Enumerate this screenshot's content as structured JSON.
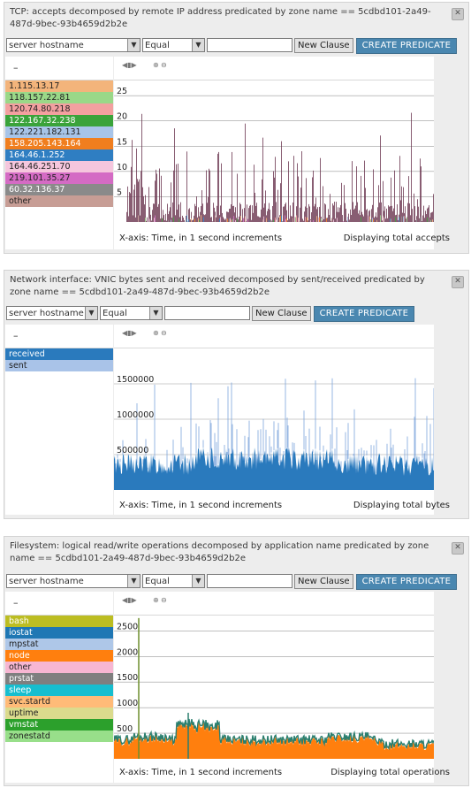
{
  "common": {
    "field_select": "server hostname",
    "operator_select": "Equal",
    "new_clause": "New Clause",
    "create_predicate": "CREATE PREDICATE",
    "legend_collapse": "–",
    "x_axis_label": "X-axis: Time, in 1 second increments",
    "close_glyph": "✕"
  },
  "panels": [
    {
      "title": "TCP: accepts decomposed by remote IP address predicated by zone name == 5cdbd101-2a49-487d-9bec-93b4659d2b2e",
      "summary": "Displaying total accepts",
      "legend": [
        {
          "label": "1.115.13.17",
          "color": "#f3b47b"
        },
        {
          "label": "118.157.22.81",
          "color": "#9ad888"
        },
        {
          "label": "120.74.80.218",
          "color": "#f3a0a0"
        },
        {
          "label": "122.167.32.238",
          "color": "#3aa33a"
        },
        {
          "label": "122.221.182.131",
          "color": "#a7c4e8"
        },
        {
          "label": "158.205.143.164",
          "color": "#f07e1e"
        },
        {
          "label": "164.46.1.252",
          "color": "#2f7ec2"
        },
        {
          "label": "164.46.251.70",
          "color": "#f5c6dd"
        },
        {
          "label": "219.101.35.27",
          "color": "#d46bc4"
        },
        {
          "label": "60.32.136.37",
          "color": "#8a8a8a"
        },
        {
          "label": "other",
          "color": "#c79d95"
        }
      ],
      "chart_data": {
        "type": "bar",
        "y_ticks": [
          5,
          10,
          15,
          20,
          25
        ],
        "ylim": [
          0,
          28
        ]
      }
    },
    {
      "title": "Network interface: VNIC bytes sent and received decomposed by sent/received predicated by zone name == 5cdbd101-2a49-487d-9bec-93b4659d2b2e",
      "summary": "Displaying total bytes",
      "legend": [
        {
          "label": "received",
          "color": "#2a7abd"
        },
        {
          "label": "sent",
          "color": "#a9c3e8"
        }
      ],
      "chart_data": {
        "type": "area",
        "y_ticks": [
          500000,
          1000000,
          1500000
        ],
        "ylim": [
          0,
          2000000
        ]
      }
    },
    {
      "title": "Filesystem: logical read/write operations decomposed by application name predicated by zone name == 5cdbd101-2a49-487d-9bec-93b4659d2b2e",
      "summary": "Displaying total operations",
      "legend": [
        {
          "label": "bash",
          "color": "#bcbd22"
        },
        {
          "label": "iostat",
          "color": "#1f77b4"
        },
        {
          "label": "mpstat",
          "color": "#aec7e8"
        },
        {
          "label": "node",
          "color": "#ff7f0e"
        },
        {
          "label": "other",
          "color": "#f7b6d2"
        },
        {
          "label": "prstat",
          "color": "#7f7f7f"
        },
        {
          "label": "sleep",
          "color": "#17becf"
        },
        {
          "label": "svc.startd",
          "color": "#ffbb78"
        },
        {
          "label": "uptime",
          "color": "#dbdb8d"
        },
        {
          "label": "vmstat",
          "color": "#2ca02c"
        },
        {
          "label": "zonestatd",
          "color": "#98df8a"
        }
      ],
      "chart_data": {
        "type": "area",
        "y_ticks": [
          500,
          1000,
          1500,
          2000,
          2500
        ],
        "ylim": [
          0,
          2800
        ]
      }
    }
  ]
}
